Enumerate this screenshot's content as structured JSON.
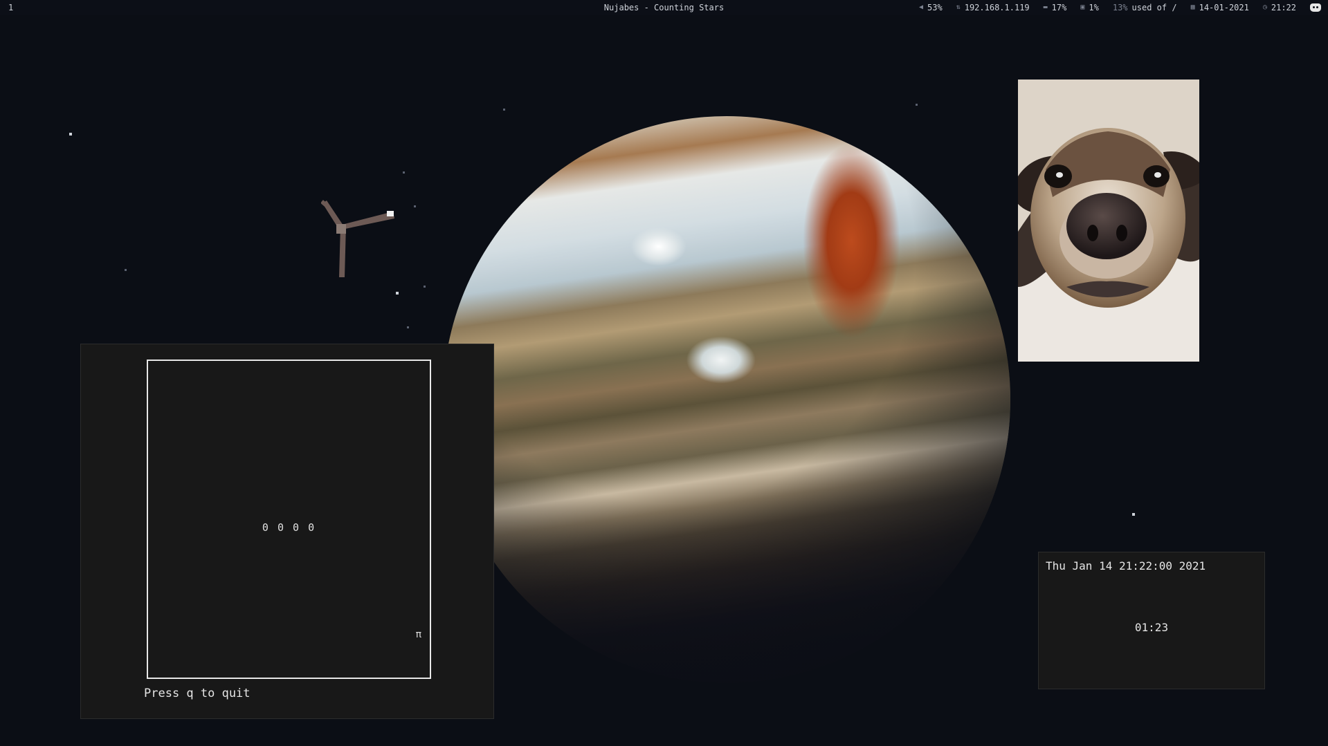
{
  "topbar": {
    "workspace": "1",
    "window_title": "Nujabes - Counting Stars",
    "volume": "53%",
    "ip": "192.168.1.119",
    "memory": "17%",
    "cpu": "1%",
    "disk_percent": "13%",
    "disk_label": "used of /",
    "date": "14-01-2021",
    "time": "21:22",
    "icons": [
      "volume-icon",
      "network-icon",
      "memory-icon",
      "cpu-icon",
      "calendar-icon",
      "clock-icon",
      "discord-icon"
    ]
  },
  "terminal": {
    "digits": "0 0 0 0",
    "symbol": "π",
    "quit_hint": "Press q to quit"
  },
  "clock_window": {
    "datetime": "Thu Jan 14 21:22:00 2021",
    "timer": "01:23"
  },
  "colors": {
    "background": "#0b0e15",
    "window_bg": "#181818",
    "text": "#e6e6e6"
  }
}
